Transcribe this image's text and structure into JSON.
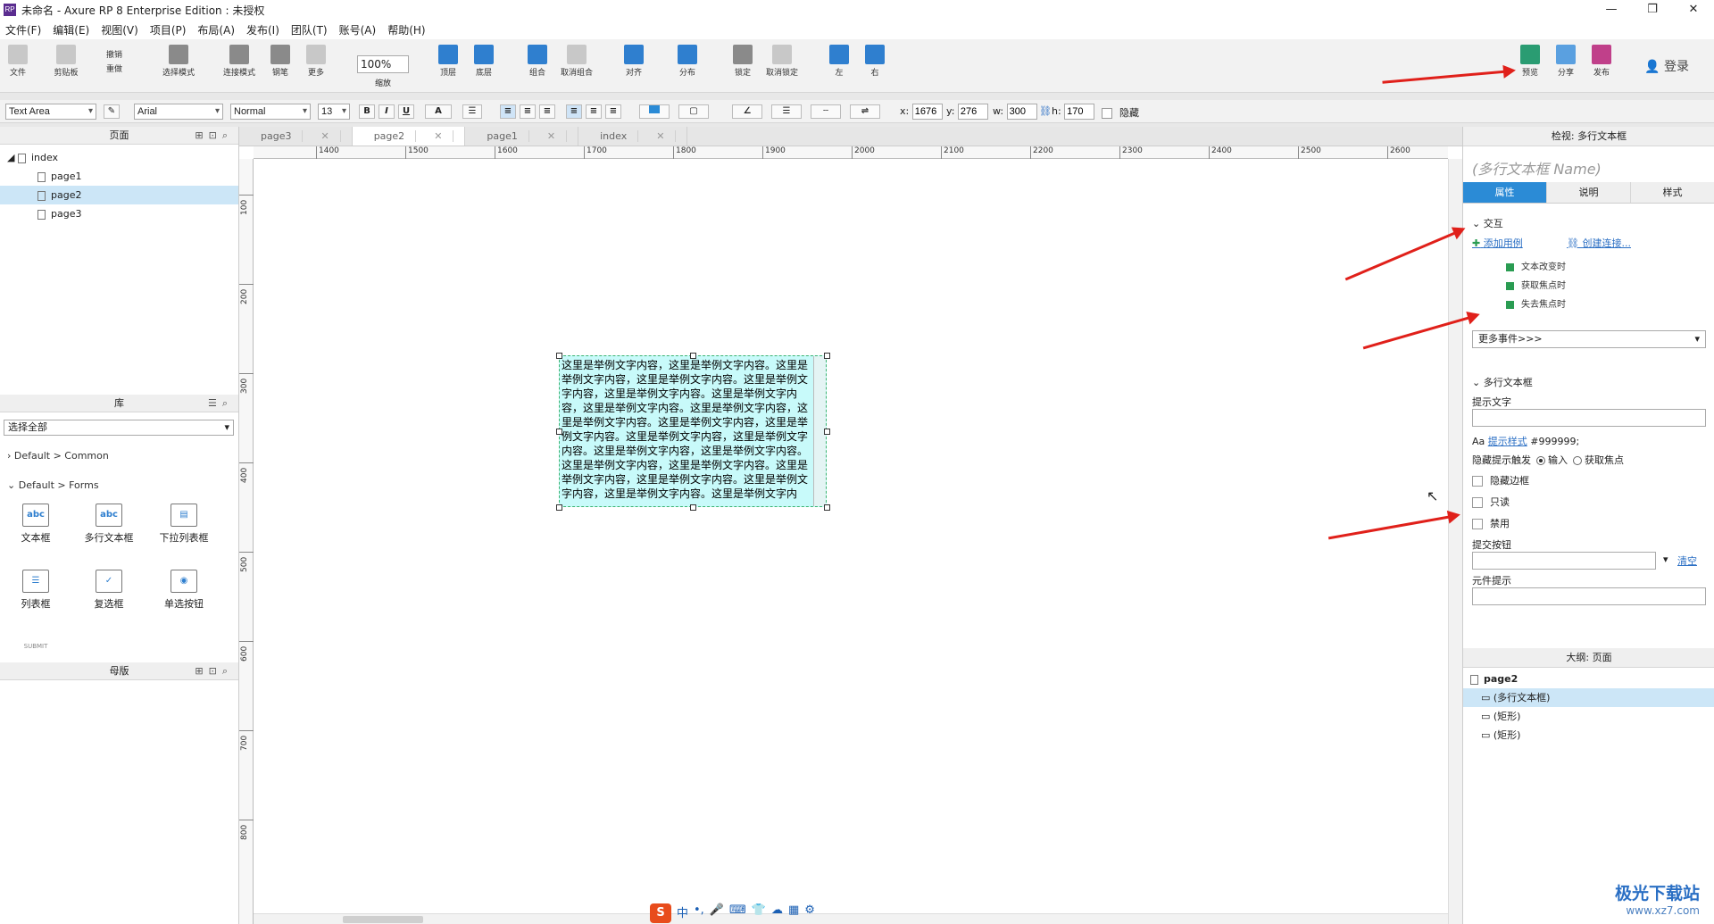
{
  "window": {
    "title": "未命名 - Axure RP 8 Enterprise Edition : 未授权",
    "app_icon": "RP",
    "controls": [
      "—",
      "❐",
      "✕"
    ]
  },
  "menu": [
    "文件(F)",
    "编辑(E)",
    "视图(V)",
    "项目(P)",
    "布局(A)",
    "发布(I)",
    "团队(T)",
    "账号(A)",
    "帮助(H)"
  ],
  "toolbar": {
    "file": "文件",
    "clipboard": "剪贴板",
    "undo": "撤销",
    "redo": "重做",
    "select_mode": "选择模式",
    "connect_mode": "连接模式",
    "pen": "钢笔",
    "more": "更多",
    "zoom_value": "100%",
    "zoom_label": "缩放",
    "top": "顶层",
    "bottom": "底层",
    "group": "组合",
    "ungroup": "取消组合",
    "align": "对齐",
    "distribute": "分布",
    "lock": "锁定",
    "unlock": "取消锁定",
    "left": "左",
    "right": "右",
    "preview": "预览",
    "share": "分享",
    "publish": "发布",
    "login": "登录"
  },
  "format": {
    "widget_type": "Text Area",
    "font": "Arial",
    "weight": "Normal",
    "size": "13",
    "bold": "B",
    "italic": "I",
    "underline": "U",
    "font_color": "A",
    "x_label": "x:",
    "x": "1676",
    "y_label": "y:",
    "y": "276",
    "w_label": "w:",
    "w": "300",
    "h_label": "h:",
    "h": "170",
    "hide": "隐藏"
  },
  "pages_panel": {
    "title": "页面",
    "root": "index",
    "pages": [
      "page1",
      "page2",
      "page3"
    ],
    "selected": "page2"
  },
  "library_panel": {
    "title": "库",
    "select": "选择全部",
    "sections": [
      "Default > Common",
      "Default > Forms"
    ],
    "widgets": [
      {
        "label": "文本框",
        "icon": "abc"
      },
      {
        "label": "多行文本框",
        "icon": "abc"
      },
      {
        "label": "下拉列表框",
        "icon": "▤"
      },
      {
        "label": "列表框",
        "icon": "☰"
      },
      {
        "label": "复选框",
        "icon": "✓"
      },
      {
        "label": "单选按钮",
        "icon": "◉"
      }
    ],
    "submit_icon": "SUBMIT"
  },
  "masters_panel": {
    "title": "母版"
  },
  "tabs": [
    "page3",
    "page2",
    "page1",
    "index"
  ],
  "active_tab": "page2",
  "ruler": {
    "h": [
      "1400",
      "1500",
      "1600",
      "1700",
      "1800",
      "1900",
      "2000",
      "2100",
      "2200",
      "2300",
      "2400",
      "2500",
      "2600"
    ],
    "v": [
      "100",
      "200",
      "300",
      "400",
      "500",
      "600",
      "700",
      "800"
    ]
  },
  "canvas_widget": {
    "text": "这里是举例文字内容，这里是举例文字内容。这里是举例文字内容，这里是举例文字内容。这里是举例文字内容，这里是举例文字内容。这里是举例文字内容，这里是举例文字内容。这里是举例文字内容，这里是举例文字内容。这里是举例文字内容，这里是举例文字内容。这里是举例文字内容，这里是举例文字内容。这里是举例文字内容，这里是举例文字内容。这里是举例文字内容，这里是举例文字内容。这里是举例文字内容，这里是举例文字内容。这里是举例文字内容，这里是举例文字内容。这里是举例文字内"
  },
  "ime_bar": [
    "S",
    "中",
    "•,",
    "🎤",
    "⌨",
    "👕",
    "☁",
    "▦",
    "⚙"
  ],
  "inspector": {
    "title": "检视: 多行文本框",
    "name_placeholder": "(多行文本框 Name)",
    "tabs": [
      "属性",
      "说明",
      "样式"
    ],
    "interaction_title": "交互",
    "add_case": "添加用例",
    "create_link": "创建连接...",
    "events": [
      "文本改变时",
      "获取焦点时",
      "失去焦点时"
    ],
    "more_events": "更多事件>>>",
    "section_title": "多行文本框",
    "hint_label": "提示文字",
    "hint_style_link": "提示样式",
    "hint_style_value": "#999999;",
    "hint_trigger_label": "隐藏提示触发",
    "trigger_input": "输入",
    "trigger_focus": "获取焦点",
    "hide_border": "隐藏边框",
    "readonly": "只读",
    "disabled": "禁用",
    "submit_label": "提交按钮",
    "clear": "清空",
    "tooltip_label": "元件提示"
  },
  "outline_panel": {
    "title": "大纲: 页面",
    "items": [
      "page2",
      "(多行文本框)",
      "(矩形)",
      "(矩形)"
    ]
  },
  "watermark": {
    "title": "极光下载站",
    "url": "www.xz7.com"
  },
  "colors": {
    "accent": "#2b8bd6",
    "arrow": "#e0201a",
    "widget_fill": "#c8fafa",
    "event_green": "#2a9c52"
  }
}
